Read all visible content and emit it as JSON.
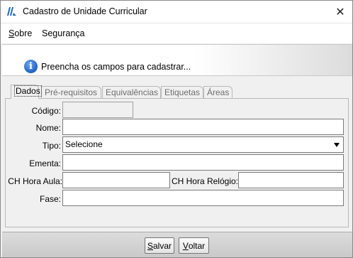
{
  "window": {
    "title": "Cadastro de Unidade Curricular"
  },
  "menu": {
    "sobre": {
      "first": "S",
      "rest": "obre"
    },
    "seguranca": {
      "first": "S",
      "rest": "egurança"
    }
  },
  "header": {
    "info_text": "Preencha os campos para cadastrar..."
  },
  "tabs": [
    "Dados",
    "Pré-requisitos",
    "Equivalências",
    "Etiquetas",
    "Áreas"
  ],
  "form": {
    "codigo": {
      "label": "Código:",
      "value": ""
    },
    "nome": {
      "label": "Nome:",
      "value": ""
    },
    "tipo": {
      "label": "Tipo:",
      "value": "Selecione"
    },
    "ementa": {
      "label": "Ementa:",
      "value": ""
    },
    "ch_aula": {
      "label": "CH Hora Aula:",
      "value": ""
    },
    "ch_relogio": {
      "label": "CH Hora Relógio:",
      "value": ""
    },
    "fase": {
      "label": "Fase:",
      "value": ""
    }
  },
  "buttons": {
    "salvar": {
      "first": "S",
      "rest": "alvar"
    },
    "voltar": {
      "first": "V",
      "rest": "oltar"
    }
  },
  "icons": {
    "app": "logo-icon",
    "close": "close-icon",
    "info": "info-icon",
    "dropdown": "chevron-down-icon"
  },
  "colors": {
    "info_blue": "#1f5fc4",
    "footer_gray": "#c9c9c9"
  }
}
